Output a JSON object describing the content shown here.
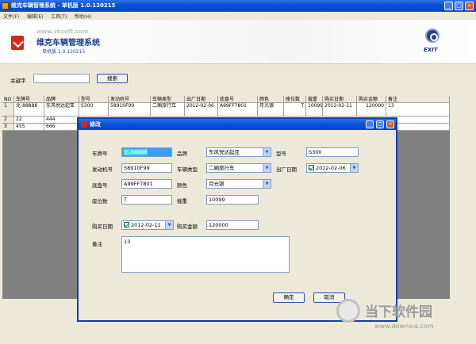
{
  "window": {
    "title": "维克车辆管理系统 - 单机版 1.0.120215"
  },
  "menu": [
    "文件(F)",
    "编辑(E)",
    "工具(T)",
    "帮助(H)"
  ],
  "banner": {
    "url": "www.vksoft.com",
    "title": "维克车辆管理系统",
    "version": "单机版 1.0.120215",
    "exit_label": "EXIT"
  },
  "search": {
    "label": "关键字",
    "value": "",
    "button": "搜索"
  },
  "grid": {
    "columns": [
      "NO",
      "车牌号",
      "品牌",
      "型号",
      "发动机号",
      "车辆类型",
      "出厂日期",
      "底盘号",
      "颜色",
      "座位数",
      "载重",
      "购买日期",
      "购买金额",
      "备注"
    ],
    "rows": [
      [
        "1",
        "北-88888",
        "东风悦达起亚",
        "S300",
        "58910F99",
        "二厢旅行车",
        "2012-02-06",
        "A99FF7801",
        "月光银",
        "T",
        "10099",
        "2012-02-11",
        "120000",
        "13"
      ],
      [
        "2",
        "22",
        "444",
        "",
        "",
        "",
        "",
        "",
        "",
        "",
        "",
        "",
        "",
        ""
      ],
      [
        "3",
        "455",
        "666",
        "",
        "",
        "",
        "",
        "",
        "",
        "",
        "",
        "",
        "",
        ""
      ]
    ]
  },
  "dialog": {
    "title": "修改",
    "fields": {
      "plate_label": "车牌号",
      "plate_value": "北-88888",
      "brand_label": "品牌",
      "brand_value": "东风悦达起亚",
      "model_label": "型号",
      "model_value": "S300",
      "engine_label": "发动机号",
      "engine_value": "58910F99",
      "type_label": "车辆类型",
      "type_value": "二厢旅行车",
      "factory_date_label": "出厂日期",
      "factory_date_value": "2012-02-06",
      "chassis_label": "底盘号",
      "chassis_value": "A99FF7801",
      "color_label": "颜色",
      "color_value": "月光银",
      "seats_label": "座位数",
      "seats_value": "T",
      "load_label": "载重",
      "load_value": "10099",
      "buy_date_label": "购买日期",
      "buy_date_value": "2012-02-11",
      "price_label": "购买金额",
      "price_value": "120000",
      "note_label": "备注",
      "note_value": "13"
    },
    "ok_button": "确定",
    "cancel_button": "取消"
  },
  "watermark": {
    "text": "当下软件园",
    "url": "www.downxia.com"
  }
}
